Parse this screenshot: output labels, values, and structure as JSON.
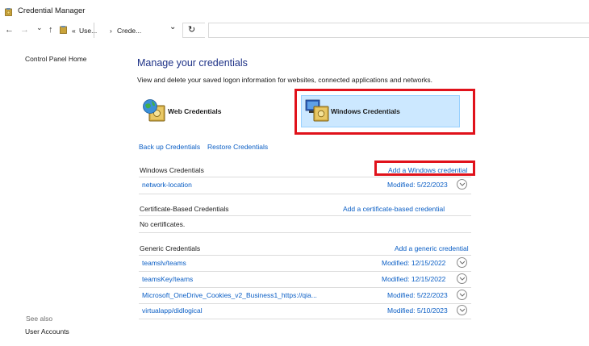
{
  "window": {
    "title": "Credential Manager"
  },
  "address_bar": {
    "back": "←",
    "forward": "→",
    "recent": "⌄",
    "up": "↑",
    "overflow": "«",
    "crumb1": "Use...",
    "sep": "›",
    "crumb2": "Crede...",
    "dropdown": "⌄",
    "refresh": "↻"
  },
  "left_nav": {
    "home": "Control Panel Home",
    "see_also": "See also",
    "user_accounts": "User Accounts"
  },
  "main": {
    "heading": "Manage your credentials",
    "subtext": "View and delete your saved logon information for websites, connected applications and networks.",
    "web_credentials": "Web Credentials",
    "windows_credentials": "Windows Credentials",
    "backup": "Back up Credentials",
    "restore": "Restore Credentials"
  },
  "sections": {
    "windows": {
      "title": "Windows Credentials",
      "action": "Add a Windows credential",
      "rows": [
        {
          "name": "network-location",
          "modified": "Modified:  5/22/2023"
        }
      ]
    },
    "certificate": {
      "title": "Certificate-Based Credentials",
      "action": "Add a certificate-based credential",
      "empty": "No certificates."
    },
    "generic": {
      "title": "Generic Credentials",
      "action": "Add a generic credential",
      "rows": [
        {
          "name": "teamslv/teams",
          "modified": "Modified:  12/15/2022"
        },
        {
          "name": "teamsKey/teams",
          "modified": "Modified:  12/15/2022"
        },
        {
          "name": "Microsoft_OneDrive_Cookies_v2_Business1_https://qia...",
          "modified": "Modified:  5/22/2023"
        },
        {
          "name": "virtualapp/didlogical",
          "modified": "Modified:  5/10/2023"
        }
      ]
    }
  },
  "colors": {
    "link": "#0a5ec5",
    "heading": "#1e3287",
    "highlight": "#cce8ff",
    "annotation": "#e0121b"
  }
}
